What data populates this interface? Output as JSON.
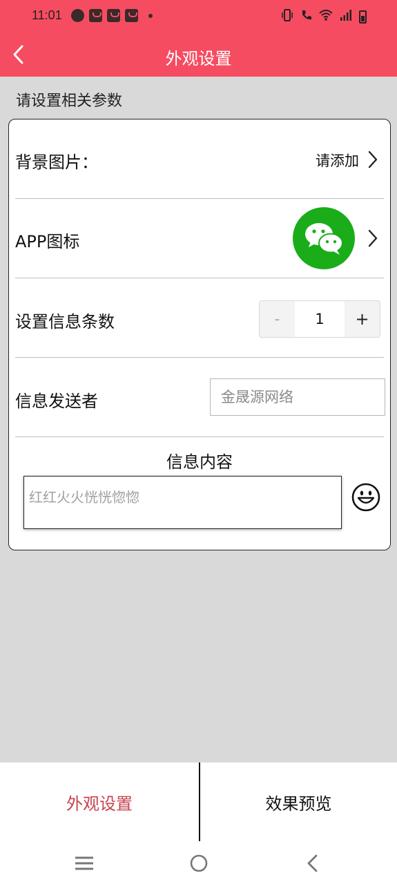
{
  "status_bar": {
    "time": "11:01",
    "left_icons": [
      "clock-badge-icon",
      "shopping-bag-icon",
      "shopping-bag-icon",
      "shopping-bag-icon",
      "dot-icon"
    ],
    "right_icons": [
      "vibrate-icon",
      "wifi-call-icon",
      "wifi-icon",
      "signal-icon",
      "battery-icon"
    ]
  },
  "header": {
    "title": "外观设置",
    "back_icon": "chevron-left-icon",
    "background_color": "#f64c61"
  },
  "section_hint": "请设置相关参数",
  "settings": {
    "background_image": {
      "label": "背景图片：",
      "action_text": "请添加",
      "icon": "chevron-right-icon"
    },
    "app_icon": {
      "label": "APP图标",
      "icon_name": "wechat-icon",
      "icon_color": "#1aad19"
    },
    "message_count": {
      "label": "设置信息条数",
      "minus_label": "-",
      "value": "1",
      "plus_label": "+"
    },
    "sender": {
      "label": "信息发送者",
      "placeholder": "金晟源网络"
    },
    "message_content": {
      "title": "信息内容",
      "placeholder": "红红火火恍恍惚惚",
      "emoji_icon": "smiley-face-icon"
    }
  },
  "tabs": [
    {
      "label": "外观设置",
      "active": true,
      "active_color": "#c8434f"
    },
    {
      "label": "效果预览",
      "active": false
    }
  ],
  "nav_bar": {
    "icons": [
      "menu-icon",
      "home-circle-icon",
      "back-icon"
    ]
  }
}
